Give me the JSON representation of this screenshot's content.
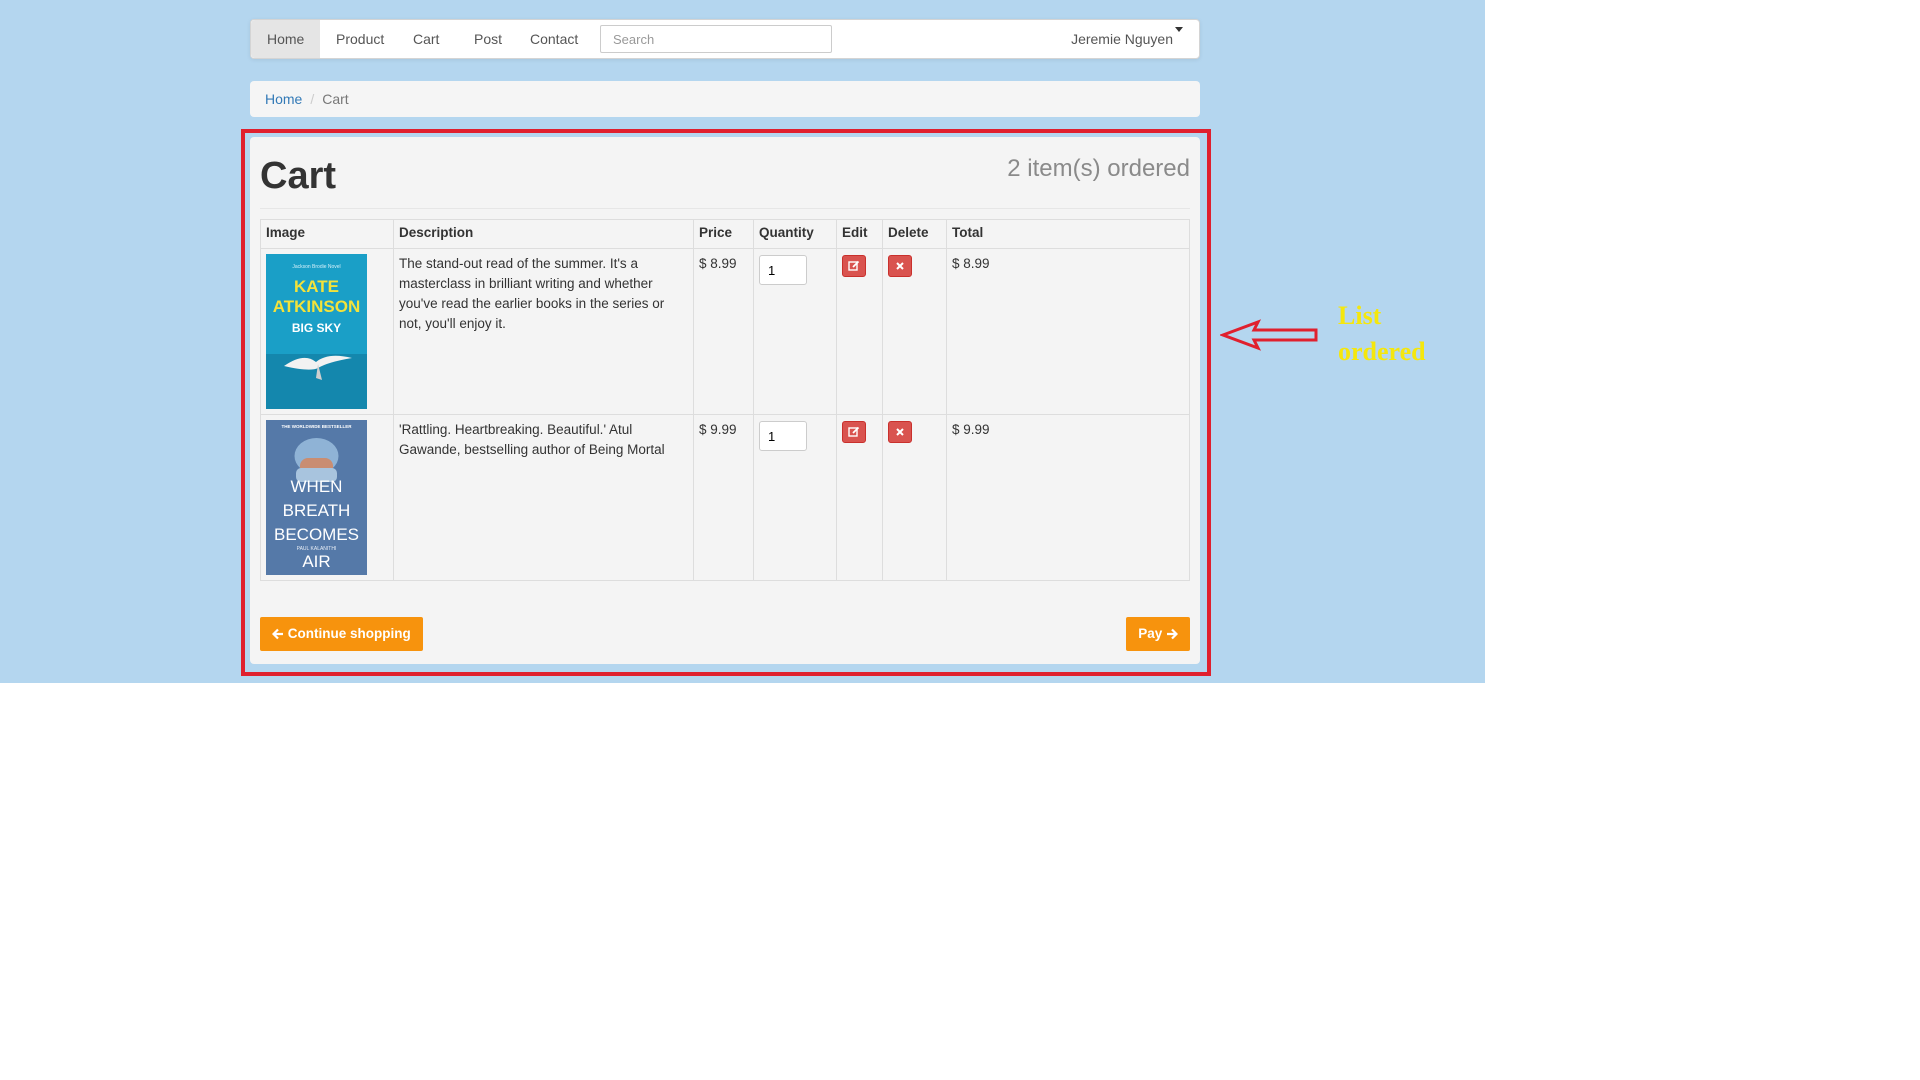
{
  "navbar": {
    "items": [
      {
        "label": "Home",
        "active": true
      },
      {
        "label": "Product"
      },
      {
        "label": "Cart"
      },
      {
        "label": "Post"
      },
      {
        "label": "Contact"
      }
    ],
    "search_placeholder": "Search",
    "user_name": "Jeremie Nguyen"
  },
  "breadcrumb": {
    "home": "Home",
    "separator": "/",
    "current": "Cart"
  },
  "cart": {
    "title": "Cart",
    "count_text": "2 item(s) ordered",
    "columns": [
      "Image",
      "Description",
      "Price",
      "Quantity",
      "Edit",
      "Delete",
      "Total"
    ],
    "rows": [
      {
        "cover": {
          "series": "Jackson Brodie Novel",
          "author_line1": "KATE",
          "author_line2": "ATKINSON",
          "title": "BIG SKY",
          "color": "#1a9fc7"
        },
        "description": "The stand-out read of the summer. It's a masterclass in brilliant writing and whether you've read the earlier books in the series or not, you'll enjoy it.",
        "price": "$ 8.99",
        "quantity": "1",
        "total": "$ 8.99"
      },
      {
        "cover": {
          "series": "THE WORLDWIDE BESTSELLER",
          "title_line1": "WHEN",
          "title_line2": "BREATH",
          "title_line3": "BECOMES",
          "title_line4": "AIR",
          "author": "PAUL KALANITHI",
          "color": "#5579a8"
        },
        "description": "'Rattling. Heartbreaking. Beautiful.' Atul Gawande, bestselling author of Being Mortal",
        "price": "$ 9.99",
        "quantity": "1",
        "total": "$ 9.99"
      }
    ],
    "continue_label": "Continue shopping",
    "pay_label": "Pay"
  },
  "annotation": {
    "line1": "List",
    "line2": "ordered"
  },
  "colors": {
    "background": "#b4d6ef",
    "highlight": "#e0202e",
    "accent_button": "#f7930d",
    "danger_button": "#d9534f",
    "annotation_text": "#f5e70d"
  }
}
